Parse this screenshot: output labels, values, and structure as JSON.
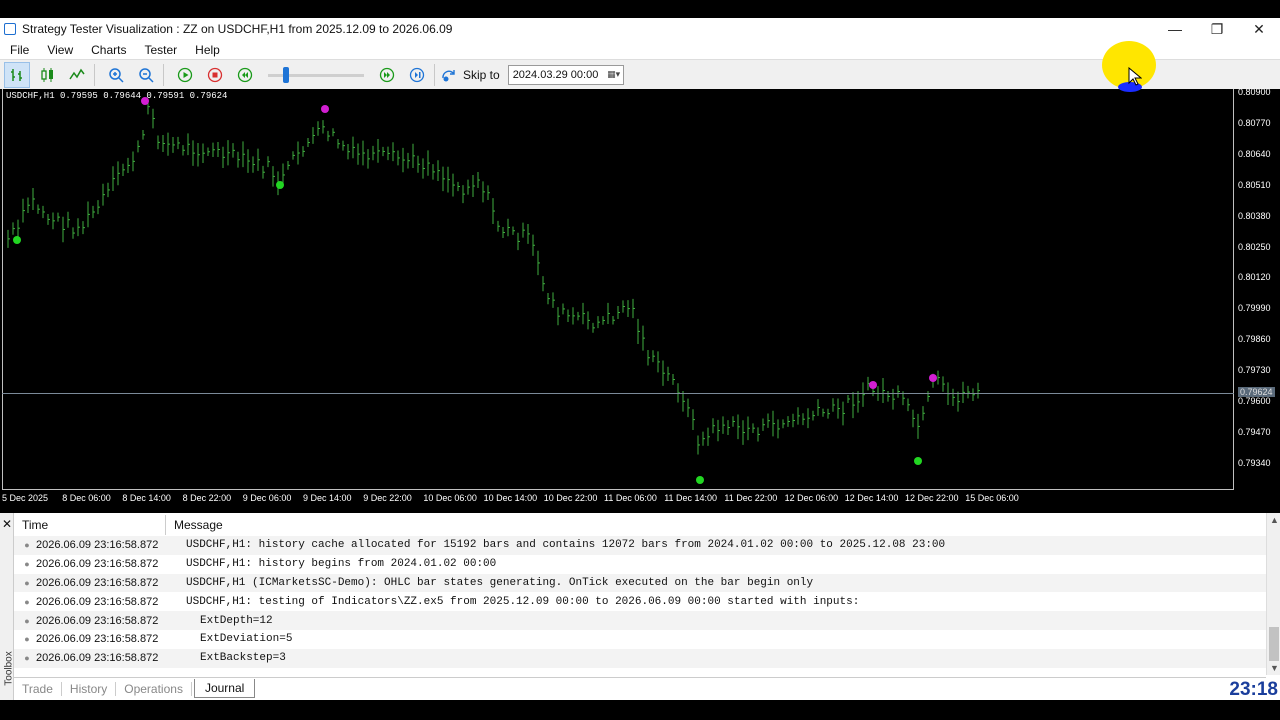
{
  "window": {
    "title": "Strategy Tester Visualization : ZZ on USDCHF,H1 from 2025.12.09 to 2026.06.09",
    "minimize": "—",
    "restore": "❐",
    "close": "✕"
  },
  "menu": [
    "File",
    "View",
    "Charts",
    "Tester",
    "Help"
  ],
  "toolbar": {
    "skip_to_label": "Skip to",
    "skip_to_value": "2024.03.29 00:00",
    "speed_level": 0.17
  },
  "chart": {
    "info": "USDCHF,H1  0.79595 0.79644 0.79591 0.79624",
    "current_price": "0.79624",
    "price_labels": [
      "0.80900",
      "0.80770",
      "0.80640",
      "0.80510",
      "0.80380",
      "0.80250",
      "0.80120",
      "0.79990",
      "0.79860",
      "0.79730",
      "0.79600",
      "0.79470",
      "0.79340"
    ],
    "time_labels": [
      "5 Dec 2025",
      "8 Dec 06:00",
      "8 Dec 14:00",
      "8 Dec 22:00",
      "9 Dec 06:00",
      "9 Dec 14:00",
      "9 Dec 22:00",
      "10 Dec 06:00",
      "10 Dec 14:00",
      "10 Dec 22:00",
      "11 Dec 06:00",
      "11 Dec 14:00",
      "11 Dec 22:00",
      "12 Dec 06:00",
      "12 Dec 14:00",
      "12 Dec 22:00",
      "15 Dec 06:00"
    ],
    "colors": {
      "bars": "#3fae3f",
      "zz_high": "#d21fd2",
      "zz_low": "#22d622"
    }
  },
  "journal": {
    "headers": {
      "time": "Time",
      "message": "Message"
    },
    "rows": [
      {
        "time": "2026.06.09 23:16:58.872",
        "message": "USDCHF,H1: history cache allocated for 15192 bars and contains 12072 bars from 2024.01.02 00:00 to 2025.12.08 23:00"
      },
      {
        "time": "2026.06.09 23:16:58.872",
        "message": "USDCHF,H1: history begins from 2024.01.02 00:00"
      },
      {
        "time": "2026.06.09 23:16:58.872",
        "message": "USDCHF,H1 (ICMarketsSC-Demo): OHLC bar states generating. OnTick executed on the bar begin only"
      },
      {
        "time": "2026.06.09 23:16:58.872",
        "message": "USDCHF,H1: testing of Indicators\\ZZ.ex5 from 2025.12.09 00:00 to 2026.06.09 00:00 started with inputs:"
      },
      {
        "time": "2026.06.09 23:16:58.872",
        "message": "ExtDepth=12"
      },
      {
        "time": "2026.06.09 23:16:58.872",
        "message": "ExtDeviation=5"
      },
      {
        "time": "2026.06.09 23:16:58.872",
        "message": "ExtBackstep=3"
      }
    ]
  },
  "tabs": [
    "Trade",
    "History",
    "Operations",
    "Journal"
  ],
  "toolbox_label": "Toolbox",
  "clock": "23:18"
}
